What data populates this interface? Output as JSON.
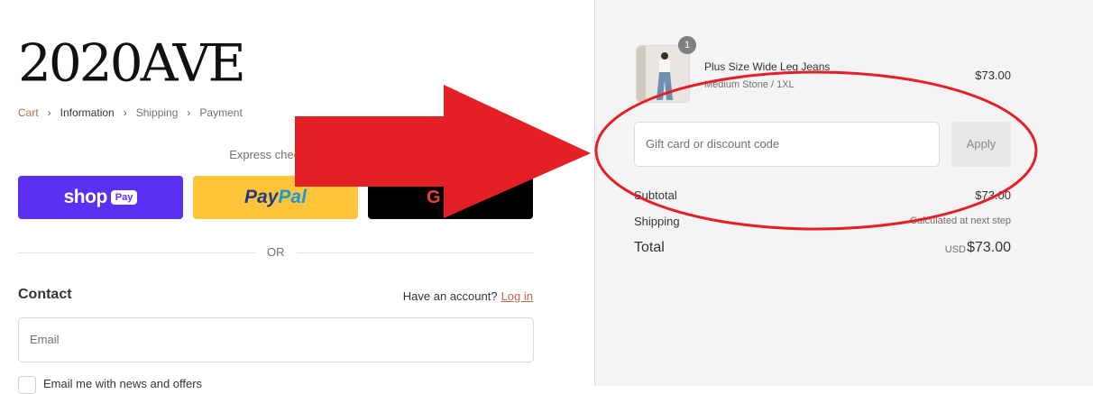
{
  "brand": {
    "logo": "2020AVE"
  },
  "breadcrumb": [
    {
      "label": "Cart",
      "state": "link"
    },
    {
      "label": "Information",
      "state": "current"
    },
    {
      "label": "Shipping",
      "state": "inactive"
    },
    {
      "label": "Payment",
      "state": "inactive"
    }
  ],
  "express": {
    "heading": "Express checkout",
    "shop": {
      "label": "shop",
      "badge": "Pay"
    },
    "paypal": {
      "part1": "Pay",
      "part2": "Pal"
    },
    "gpay": {
      "g": "G",
      "label": "Pay"
    }
  },
  "divider": {
    "label": "OR"
  },
  "contact": {
    "title": "Contact",
    "account_prompt": "Have an account?",
    "login_link": "Log in",
    "email_placeholder": "Email",
    "newsletter_label": "Email me with news and offers"
  },
  "order": {
    "item": {
      "name": "Plus Size Wide Leg Jeans",
      "variant": "Medium Stone / 1XL",
      "price": "$73.00",
      "quantity": "1"
    },
    "discount": {
      "placeholder": "Gift card or discount code",
      "apply_label": "Apply"
    },
    "subtotal_label": "Subtotal",
    "subtotal_value": "$73.00",
    "shipping_label": "Shipping",
    "shipping_value": "Calculated at next step",
    "total_label": "Total",
    "total_currency": "USD",
    "total_value": "$73.00"
  },
  "colors": {
    "accent": "#b8694a",
    "shop_pay": "#5a31f4",
    "paypal_yellow": "#ffc439",
    "annotation_red": "#e41f26"
  }
}
